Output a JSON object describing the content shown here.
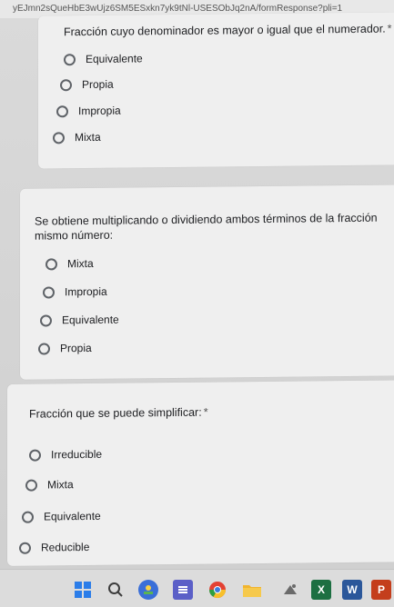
{
  "browser": {
    "url_fragment": "yEJmn2sQueHbE3wUjz6SM5ESxkn7yk9tNl-USESObJq2nA/formResponse?pli=1"
  },
  "questions": [
    {
      "text": "Fracción cuyo denominador es mayor o igual que el numerador.",
      "required_mark": "*",
      "options": [
        "Equivalente",
        "Propia",
        "Impropia",
        "Mixta"
      ]
    },
    {
      "text": "Se obtiene multiplicando o dividiendo ambos términos de la fracción mismo número:",
      "required_mark": "",
      "options": [
        "Mixta",
        "Impropia",
        "Equivalente",
        "Propia"
      ]
    },
    {
      "text": "Fracción que se puede simplificar:",
      "required_mark": "*",
      "options": [
        "Irreducible",
        "Mixta",
        "Equivalente",
        "Reducible"
      ]
    }
  ],
  "taskbar": {
    "icons": [
      {
        "name": "windows-start-icon",
        "color": "#2b7de9"
      },
      {
        "name": "search-icon",
        "color": "#3c3c3c"
      },
      {
        "name": "widgets-icon",
        "color": "#3a6fd8"
      },
      {
        "name": "task-view-icon",
        "color": "#5b5fc7"
      },
      {
        "name": "chrome-icon",
        "color": "#e34133"
      },
      {
        "name": "file-explorer-icon",
        "color": "#f1b42f"
      },
      {
        "name": "app-icon",
        "color": "#6a6a6a"
      },
      {
        "name": "excel-icon",
        "color": "#1d6f42",
        "glyph": "X"
      },
      {
        "name": "word-icon",
        "color": "#2b579a",
        "glyph": "W"
      },
      {
        "name": "powerpoint-icon",
        "color": "#c43e1c",
        "glyph": "P"
      }
    ]
  }
}
